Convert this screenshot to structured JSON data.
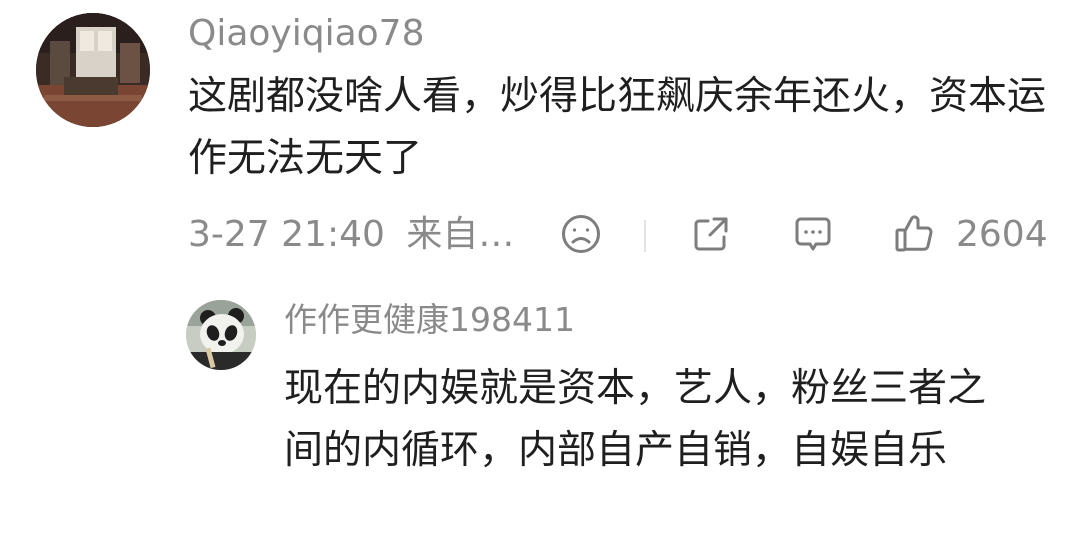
{
  "comment": {
    "username": "Qiaoyiqiao78",
    "text": "这剧都没啥人看，炒得比狂飙庆余年还火，资本运作无法无天了",
    "time": "3-27 21:40",
    "source": "来自…",
    "like_count": "2604",
    "icons": [
      "sad-face-icon",
      "share-icon",
      "comment-icon",
      "thumbs-up-icon"
    ]
  },
  "reply": {
    "username": "作作更健康198411",
    "text": "现在的内娱就是资本，艺人，粉丝三者之间的内循环，内部自产自销，自娱自乐"
  }
}
